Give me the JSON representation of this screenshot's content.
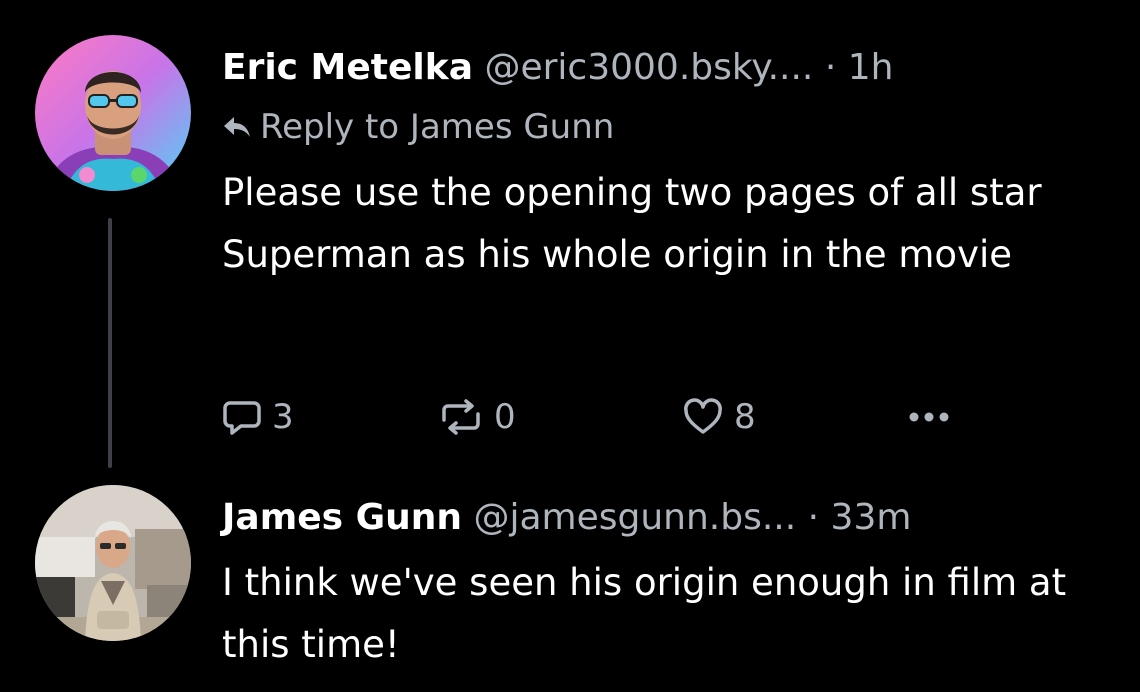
{
  "thread": {
    "parent_post": {
      "author_name": "Eric Metelka",
      "handle": "@eric3000.bsky....",
      "separator": "·",
      "time": "1h",
      "reply_to": "Reply to James Gunn",
      "text": "Please use the opening two pages of all star Superman as his whole origin in the movie",
      "reply_count": "3",
      "repost_count": "0",
      "like_count": "8",
      "icons": {
        "reply": "speech-bubble-icon",
        "repost": "repost-icon",
        "like": "heart-icon",
        "more": "ellipsis-icon",
        "reply_to": "reply-arrow-icon"
      }
    },
    "reply_post": {
      "author_name": "James Gunn",
      "handle": "@jamesgunn.bs...",
      "separator": "·",
      "time": "33m",
      "text": "I think we've seen his origin enough in film at this time!"
    }
  },
  "colors": {
    "background": "#000000",
    "primary_text": "#ffffff",
    "secondary_text": "#aeb5bd",
    "thread_line": "#3d4147"
  }
}
